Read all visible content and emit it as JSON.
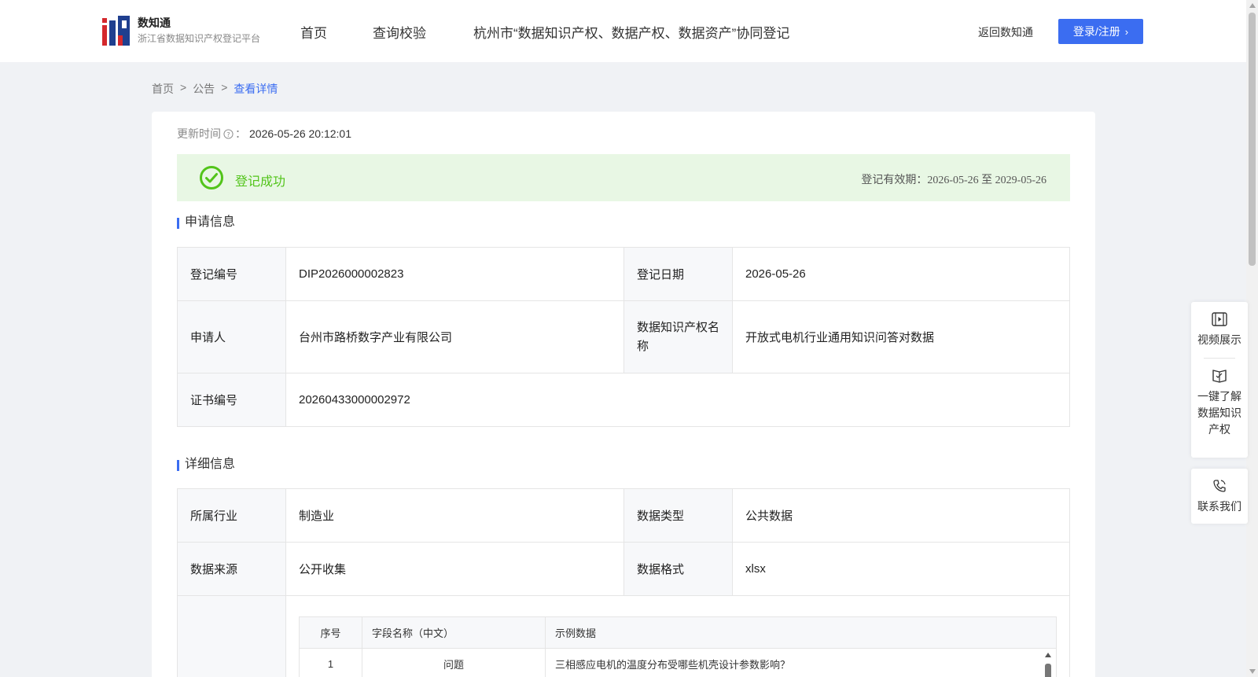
{
  "header": {
    "brand_name": "数知通",
    "brand_sub": "浙江省数据知识产权登记平台",
    "nav": [
      "首页",
      "查询校验",
      "杭州市“数据知识产权、数据产权、数据资产”协同登记"
    ],
    "back_link": "返回数知通",
    "login": "登录/注册"
  },
  "breadcrumb": {
    "home": "首页",
    "sep": ">",
    "notice": "公告",
    "current": "查看详情"
  },
  "detail": {
    "update_label": "更新时间",
    "update_colon": "：",
    "update_time": "2026-05-26 20:12:01",
    "status": "登记成功",
    "validity": "登记有效期：2026-05-26 至 2029-05-26",
    "status_color": "#52c41a"
  },
  "apply": {
    "title": "申请信息",
    "reg_no_label": "登记编号",
    "reg_no": "DIP2026000002823",
    "reg_date_label": "登记日期",
    "reg_date": "2026-05-26",
    "applicant_label": "申请人",
    "applicant": "台州市路桥数字产业有限公司",
    "ip_name_label": "数据知识产权名称",
    "ip_name": "开放式电机行业通用知识问答对数据",
    "cert_no_label": "证书编号",
    "cert_no": "20260433000002972"
  },
  "details": {
    "title": "详细信息",
    "industry_label": "所属行业",
    "industry": "制造业",
    "type_label": "数据类型",
    "type": "公共数据",
    "source_label": "数据来源",
    "source": "公开收集",
    "format_label": "数据格式",
    "format": "xlsx",
    "fields_headers": [
      "序号",
      "字段名称（中文）",
      "示例数据"
    ],
    "fields_rows": [
      [
        "1",
        "问题",
        "三相感应电机的温度分布受哪些机壳设计参数影响？"
      ]
    ]
  },
  "side": {
    "video": "视频展示",
    "learn": "一键了解数据知识产权",
    "contact": "联系我们"
  }
}
